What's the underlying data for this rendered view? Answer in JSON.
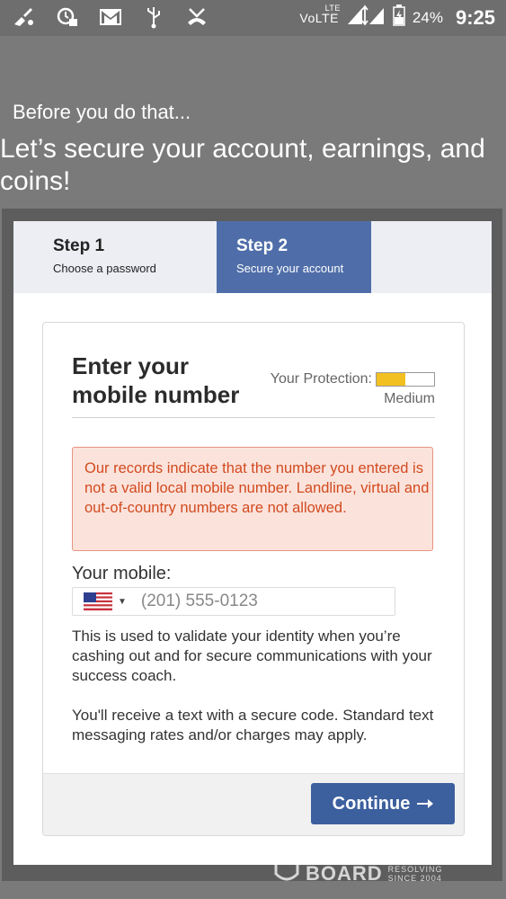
{
  "status_bar": {
    "network": "VoLTE",
    "network_sup": "LTE",
    "battery": "24%",
    "time": "9:25",
    "icons": [
      "cleaner-icon",
      "alarm-lock-icon",
      "gmail-icon",
      "usb-icon",
      "missed-call-icon",
      "signal-icon",
      "battery-icon"
    ]
  },
  "intro": {
    "before": "Before you do that...",
    "headline": "Let’s secure your account, earnings, and coins!"
  },
  "steps": [
    {
      "title": "Step 1",
      "subtitle": "Choose a password",
      "active": false
    },
    {
      "title": "Step 2",
      "subtitle": "Secure your account",
      "active": true
    }
  ],
  "card": {
    "title": "Enter your mobile number",
    "protection_label": "Your Protection:",
    "protection_level": "Medium",
    "protection_fraction": 0.5,
    "error": "Our records indicate that the number you entered is not a valid local mobile number. Landline, virtual and out-of-country numbers are not allowed.",
    "mobile_label": "Your mobile:",
    "phone_placeholder": "(201) 555-0123",
    "info1": "This is used to validate your identity when you’re cashing out and for secure communications with your success coach.",
    "info2": "You'll receive a text with a secure code. Standard text messaging rates and/or charges may apply.",
    "continue_label": "Continue"
  },
  "watermark": {
    "name": "BOARD",
    "line1": "RESOLVING",
    "line2": "SINCE 2004"
  },
  "colors": {
    "accent": "#3c5f9e",
    "step_active": "#4f6ea9",
    "error_text": "#d24a1f",
    "error_bg": "#fbe3dc",
    "meter": "#f2c021"
  }
}
